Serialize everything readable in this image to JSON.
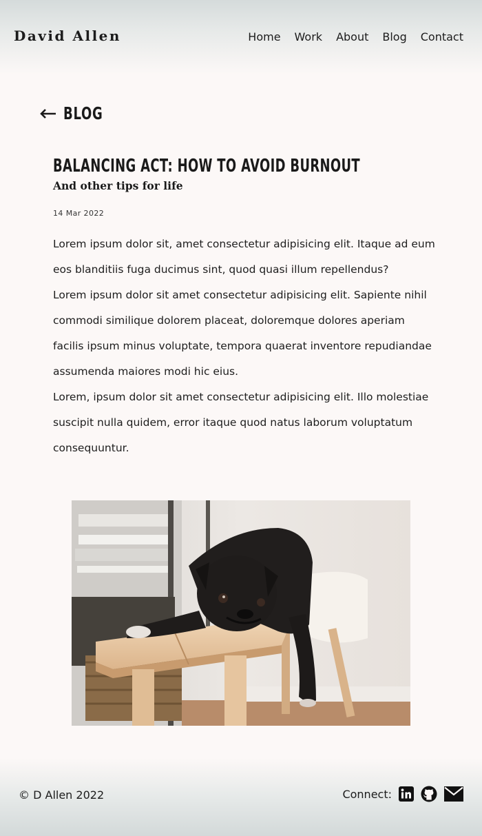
{
  "brand": "David Allen",
  "nav": [
    "Home",
    "Work",
    "About",
    "Blog",
    "Contact"
  ],
  "back": {
    "label": "BLOG",
    "icon": "arrow-left-icon"
  },
  "post": {
    "title": "BALANCING ACT: HOW TO AVOID BURNOUT",
    "subtitle": "And other tips for life",
    "date": "14 Mar 2022",
    "paragraphs": [
      "Lorem ipsum dolor sit, amet consectetur adipisicing elit. Itaque ad eum eos blanditiis fuga ducimus sint, quod quasi illum repellendus?",
      "Lorem ipsum dolor sit amet consectetur adipisicing elit. Sapiente nihil commodi similique dolorem placeat, doloremque dolores aperiam facilis ipsum minus voluptate, tempora quaerat inventore repudiandae assumenda maiores modi hic eius.",
      "Lorem, ipsum dolor sit amet consectetur adipisicing elit. Illo molestiae suscipit nulla quidem, error itaque quod natus laborum voluptatum consequuntur."
    ]
  },
  "footer": {
    "copyright": "© D Allen 2022",
    "connect_label": "Connect:",
    "icons": [
      "linkedin-icon",
      "github-icon",
      "mail-icon"
    ]
  },
  "colors": {
    "background": "#fcf8f7",
    "header_tint": "#d5dbdb",
    "text": "#1a1a1a"
  }
}
